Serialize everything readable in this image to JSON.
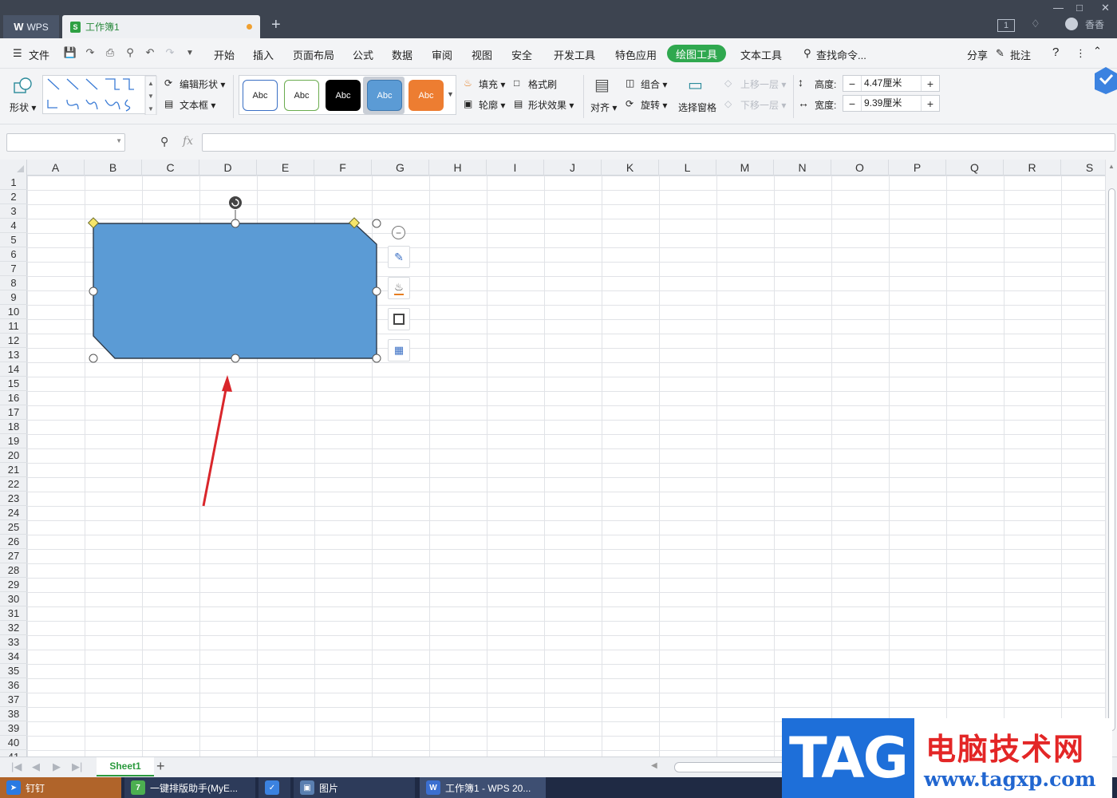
{
  "titlebar": {
    "app_tab": "WPS",
    "doc_tab": "工作簿1",
    "doc_icon": "S",
    "new_tab": "+",
    "user_name": "香香",
    "page_badge": "1"
  },
  "menubar": {
    "file": "文件",
    "items": [
      "开始",
      "插入",
      "页面布局",
      "公式",
      "数据",
      "审阅",
      "视图",
      "安全",
      "开发工具",
      "特色应用",
      "绘图工具",
      "文本工具"
    ],
    "active": "绘图工具",
    "search": "查找命令...",
    "share": "分享",
    "comment": "批注",
    "help": "?"
  },
  "ribbon": {
    "shape": "形状",
    "edit_shape": "编辑形状",
    "textbox": "文本框",
    "styles": [
      "Abc",
      "Abc",
      "Abc",
      "Abc",
      "Abc"
    ],
    "fill": "填充",
    "format_painter": "格式刷",
    "outline": "轮廓",
    "shape_effects": "形状效果",
    "align": "对齐",
    "group": "组合",
    "rotate": "旋转",
    "selection_pane": "选择窗格",
    "bring_forward": "上移一层",
    "send_backward": "下移一层",
    "height_label": "高度:",
    "height_value": "4.47厘米",
    "width_label": "宽度:",
    "width_value": "9.39厘米",
    "minus": "−",
    "plus": "+"
  },
  "formulabar": {
    "fx": "fx",
    "name_value": "",
    "formula_value": ""
  },
  "grid": {
    "columns": [
      "A",
      "B",
      "C",
      "D",
      "E",
      "F",
      "G",
      "H",
      "I",
      "J",
      "K",
      "L",
      "M",
      "N",
      "O",
      "P",
      "Q",
      "R",
      "S"
    ],
    "rows": [
      "1",
      "2",
      "3",
      "4",
      "5",
      "6",
      "7",
      "8",
      "9",
      "10",
      "11",
      "12",
      "13",
      "14",
      "15",
      "16",
      "17",
      "18",
      "19",
      "20",
      "21",
      "22",
      "23",
      "24",
      "25",
      "26",
      "27",
      "28",
      "29",
      "30",
      "31",
      "32",
      "33",
      "34",
      "35",
      "36",
      "37",
      "38",
      "39",
      "40",
      "41"
    ]
  },
  "shape": {
    "fill_color": "#5b9bd5",
    "outline_color": "#2f3b4a",
    "arrow_color": "#d9262b"
  },
  "sheets": {
    "active": "Sheet1",
    "add": "+"
  },
  "taskbar": {
    "items": [
      "钉钉",
      "一键排版助手(MyE...",
      "",
      "图片",
      "工作簿1 - WPS 20..."
    ]
  },
  "watermark": {
    "tag": "TAG",
    "site_name": "电脑技术网",
    "url": "www.tagxp.com"
  }
}
